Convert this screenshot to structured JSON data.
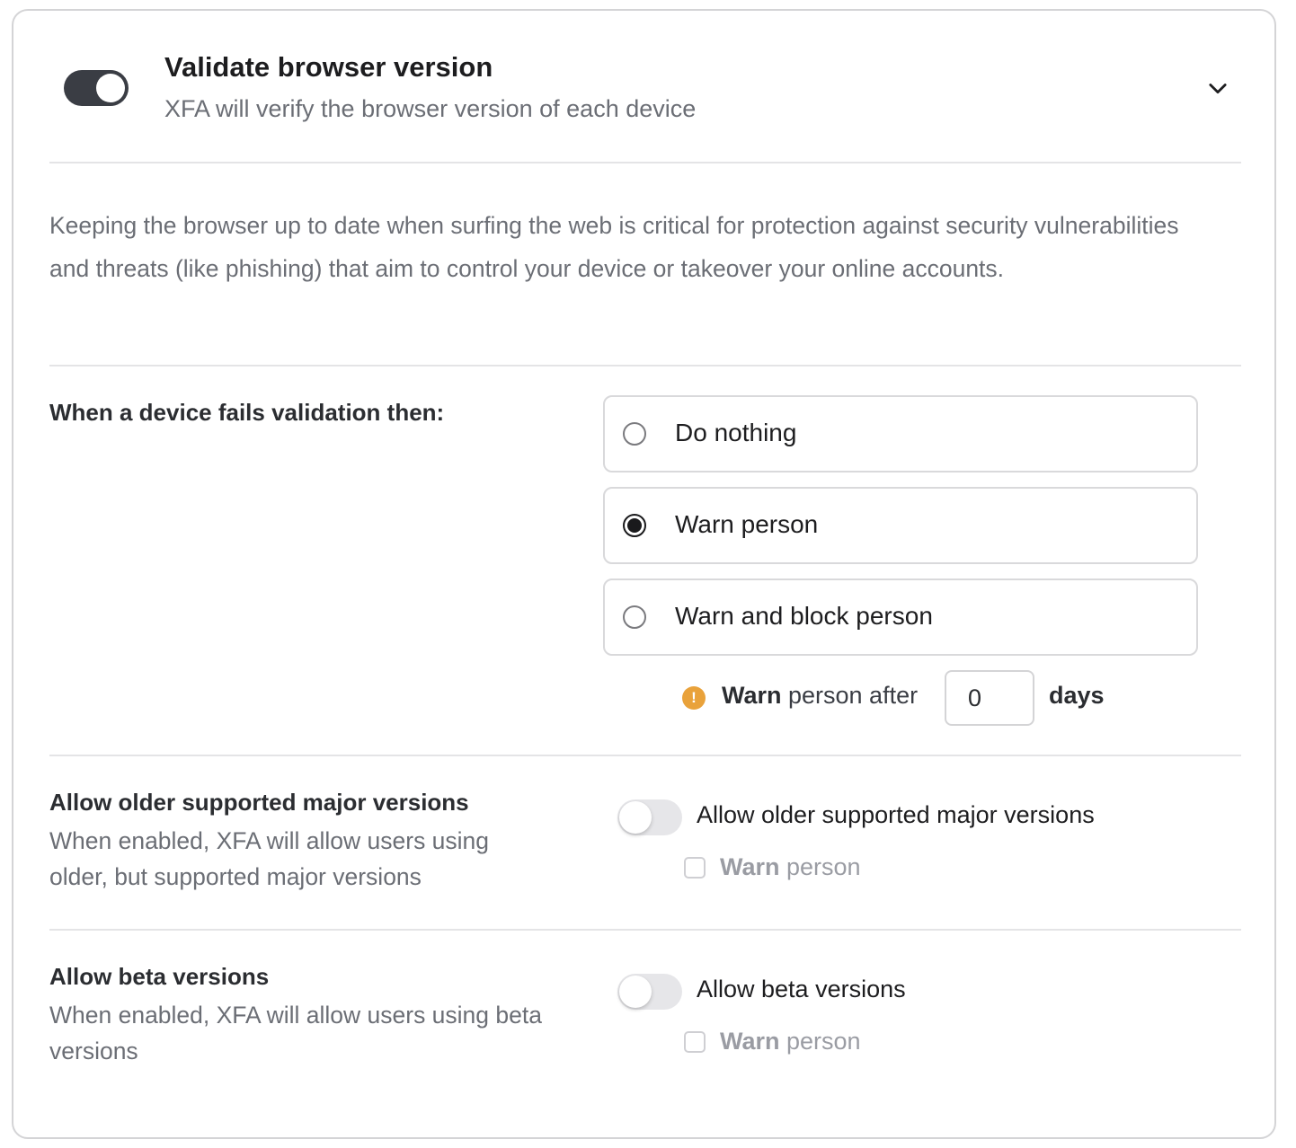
{
  "header": {
    "title": "Validate browser version",
    "subtitle": "XFA will verify the browser version of each device",
    "enabled": true
  },
  "description": "Keeping the browser up to date when surfing the web is critical for protection against security vulnerabilities and threats (like phishing) that aim to control your device or takeover your online accounts.",
  "failure": {
    "label": "When a device fails validation then:",
    "options": [
      {
        "label": "Do nothing",
        "checked": false
      },
      {
        "label": "Warn person",
        "checked": true
      },
      {
        "label": "Warn and block person",
        "checked": false
      }
    ],
    "warn_icon": "exclamation-icon",
    "warn_bold": "Warn",
    "warn_rest": " person after",
    "days_value": "0",
    "days_label": "days",
    "warn_color": "#e9a23b"
  },
  "older_versions": {
    "title": "Allow older supported major versions",
    "description": "When enabled, XFA will allow users using older, but supported major versions",
    "toggle_label": "Allow older supported major versions",
    "enabled": false,
    "checkbox_bold": "Warn",
    "checkbox_rest": " person",
    "checked": false
  },
  "beta_versions": {
    "title": "Allow beta versions",
    "description": "When enabled, XFA will allow users using beta versions",
    "toggle_label": "Allow beta versions",
    "enabled": false,
    "checkbox_bold": "Warn",
    "checkbox_rest": " person",
    "checked": false
  }
}
